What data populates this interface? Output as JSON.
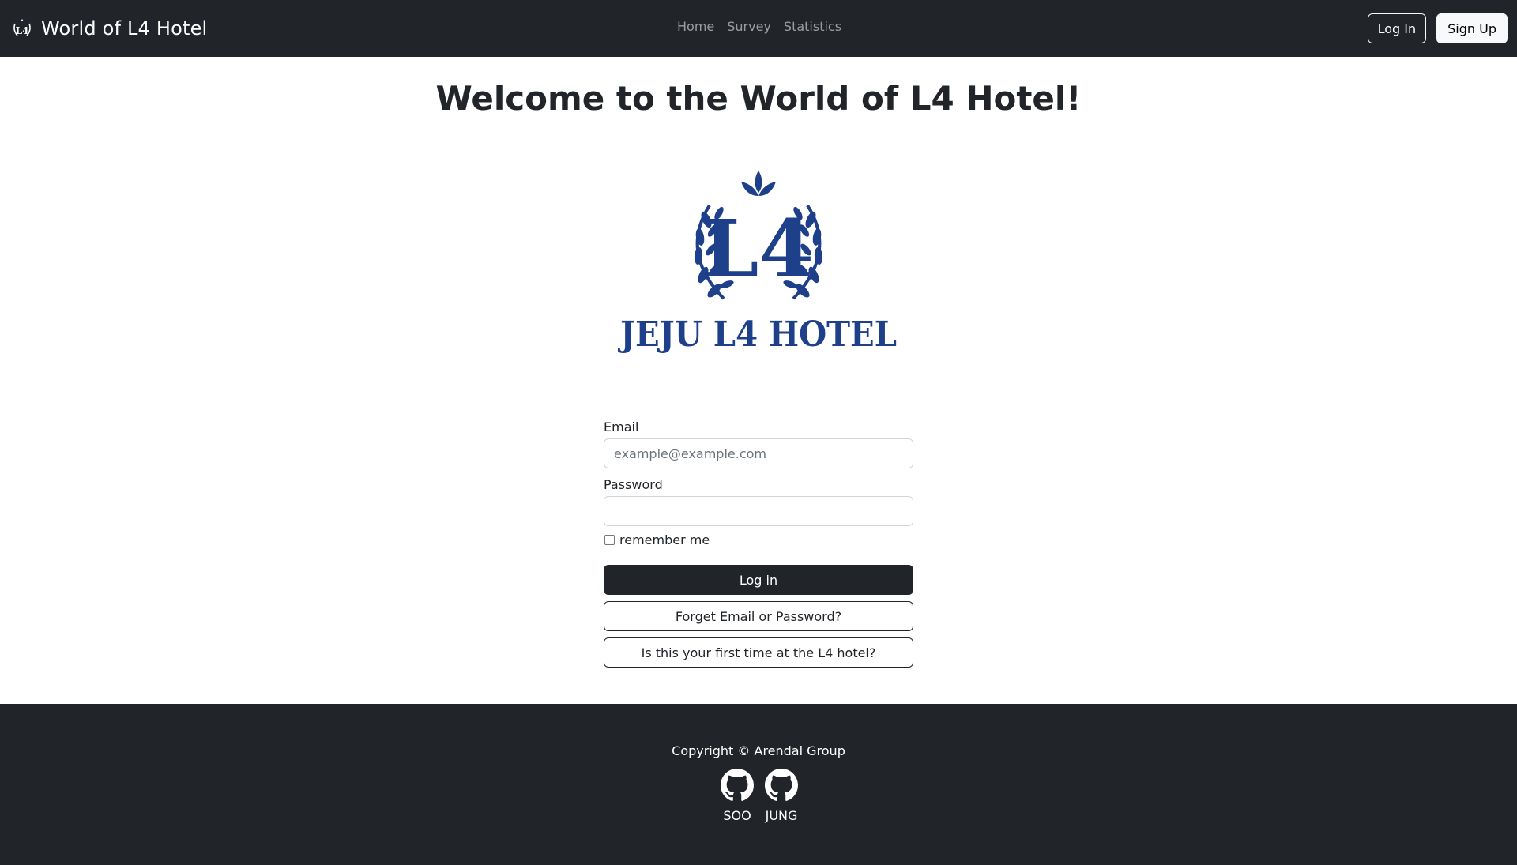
{
  "navbar": {
    "brand": "World of L4 Hotel",
    "links": [
      "Home",
      "Survey",
      "Statistics"
    ],
    "login_label": "Log In",
    "signup_label": "Sign Up"
  },
  "main": {
    "title": "Welcome to the World of L4 Hotel!",
    "logo": {
      "monogram": "L4",
      "wordmark": "JEJU L4 HOTEL",
      "color": "#1e3f8a"
    }
  },
  "form": {
    "email_label": "Email",
    "email_placeholder": "example@example.com",
    "email_value": "",
    "password_label": "Password",
    "password_value": "",
    "remember_label": "remember me",
    "remember_checked": false,
    "login_button": "Log in",
    "forgot_button": "Forget Email or Password?",
    "first_time_button": "Is this your first time at the L4 hotel?"
  },
  "footer": {
    "copyright": "Copyright © Arendal Group",
    "links": [
      {
        "name": "SOO",
        "icon": "github-icon"
      },
      {
        "name": "JUNG",
        "icon": "github-icon"
      }
    ]
  },
  "colors": {
    "dark": "#212529",
    "brand_blue": "#1e3f8a",
    "light": "#f8f9fa"
  }
}
